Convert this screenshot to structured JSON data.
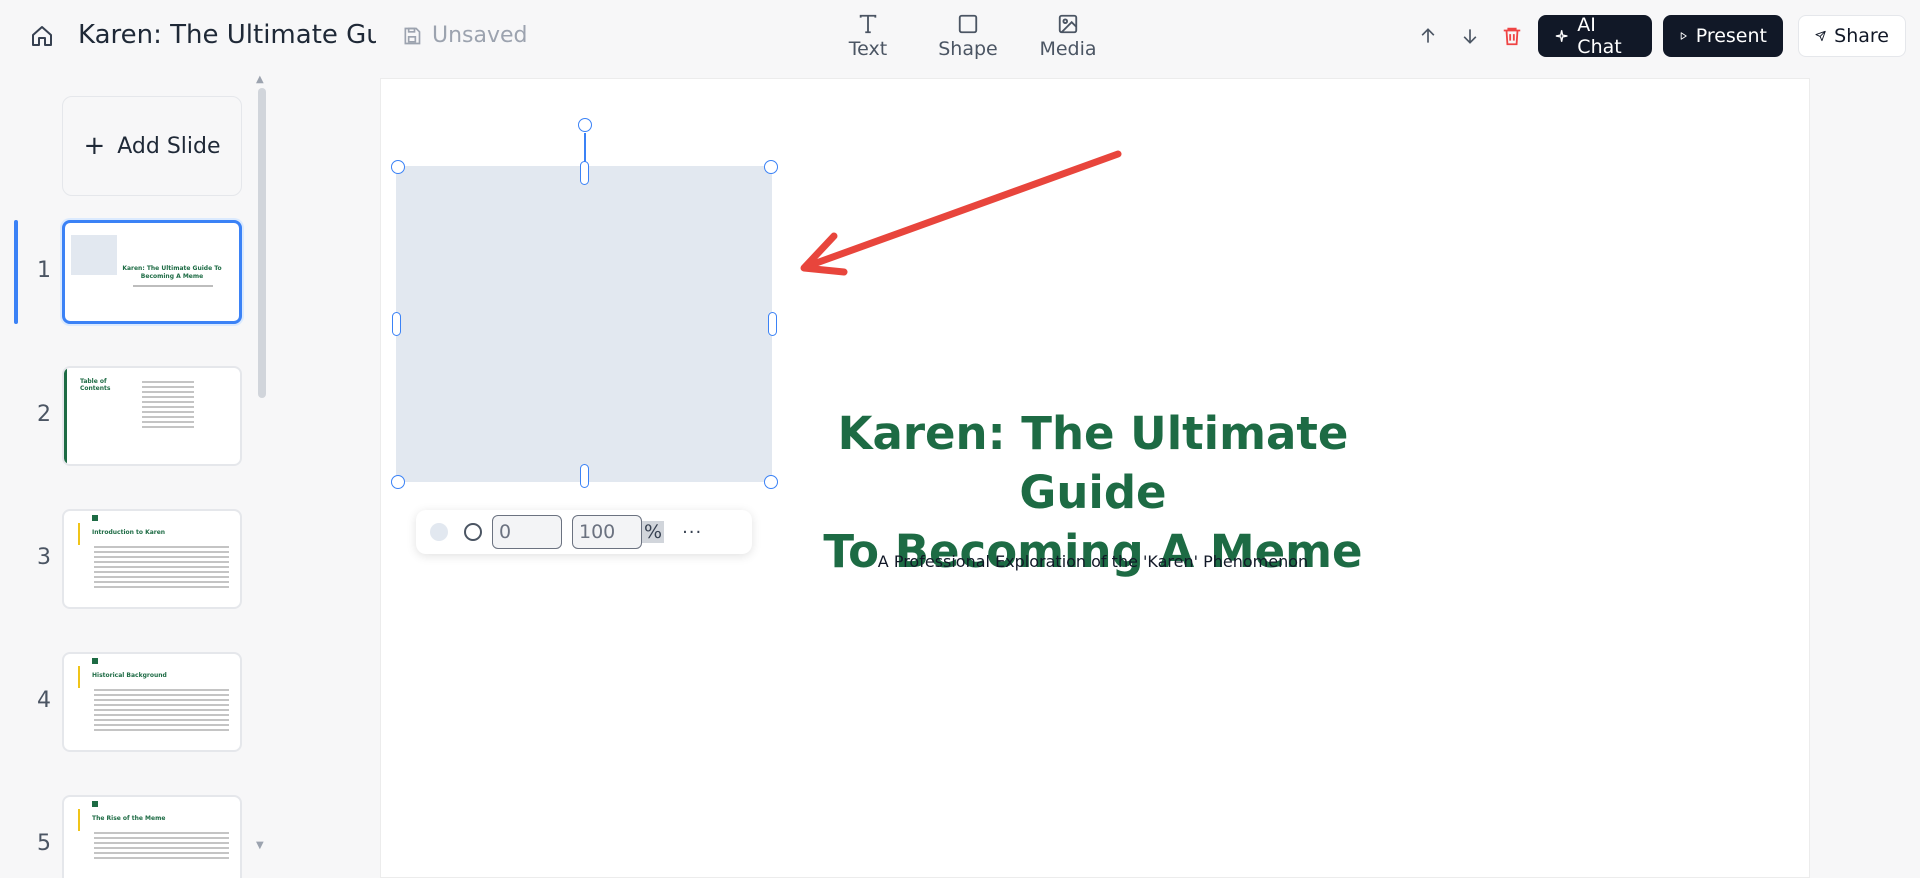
{
  "header": {
    "doc_title": "Karen: The Ultimate Guide T",
    "save_status": "Unsaved",
    "tools": [
      {
        "label": "Text",
        "icon": "text-icon"
      },
      {
        "label": "Shape",
        "icon": "square-icon"
      },
      {
        "label": "Media",
        "icon": "image-icon"
      }
    ],
    "ai_chat_label": "AI Chat",
    "present_label": "Present",
    "share_label": "Share"
  },
  "sidebar": {
    "add_slide_label": "Add Slide",
    "slides": [
      {
        "number": "1",
        "title": "Karen: The Ultimate Guide To Becoming A Meme"
      },
      {
        "number": "2",
        "title": "Table of Contents"
      },
      {
        "number": "3",
        "title": "Introduction to Karen"
      },
      {
        "number": "4",
        "title": "Historical Background"
      },
      {
        "number": "5",
        "title": "The Rise of the Meme"
      }
    ]
  },
  "slide": {
    "title_line1": "Karen: The Ultimate Guide",
    "title_line2": "To Becoming A Meme",
    "subtitle": "A Professional Exploration of the 'Karen' Phenomenon"
  },
  "shape_toolbar": {
    "border_width": "0",
    "opacity": "100",
    "opacity_unit": "%",
    "more": "···"
  },
  "colors": {
    "title_green": "#1d6b44",
    "selection_blue": "#3b82f6",
    "shape_fill": "#e2e8f0",
    "dark_button": "#111827",
    "delete_red": "#ef4444",
    "annotation_arrow": "#e8453c"
  }
}
